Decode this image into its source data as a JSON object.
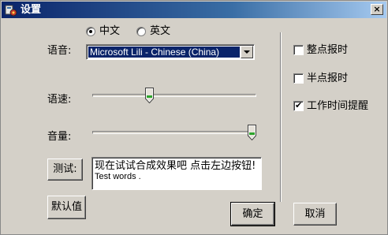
{
  "window": {
    "title": "设置",
    "close_label": "×"
  },
  "language": {
    "options": [
      {
        "label": "中文",
        "checked": true
      },
      {
        "label": "英文",
        "checked": false
      }
    ]
  },
  "voice": {
    "label": "语音:",
    "selected": "Microsoft Lili - Chinese (China)"
  },
  "speed": {
    "label": "语速:",
    "value": 0.34
  },
  "volume": {
    "label": "音量:",
    "value": 1.0
  },
  "test": {
    "button_label": "测试:",
    "text_line1": "现在试试合成效果吧 点击左边按钮!",
    "text_line2": "Test words ."
  },
  "default_button_label": "默认值",
  "ok_button_label": "确定",
  "cancel_button_label": "取消",
  "options": [
    {
      "label": "整点报时",
      "checked": false
    },
    {
      "label": "半点报时",
      "checked": false
    },
    {
      "label": "工作时间提醒",
      "checked": true
    }
  ]
}
